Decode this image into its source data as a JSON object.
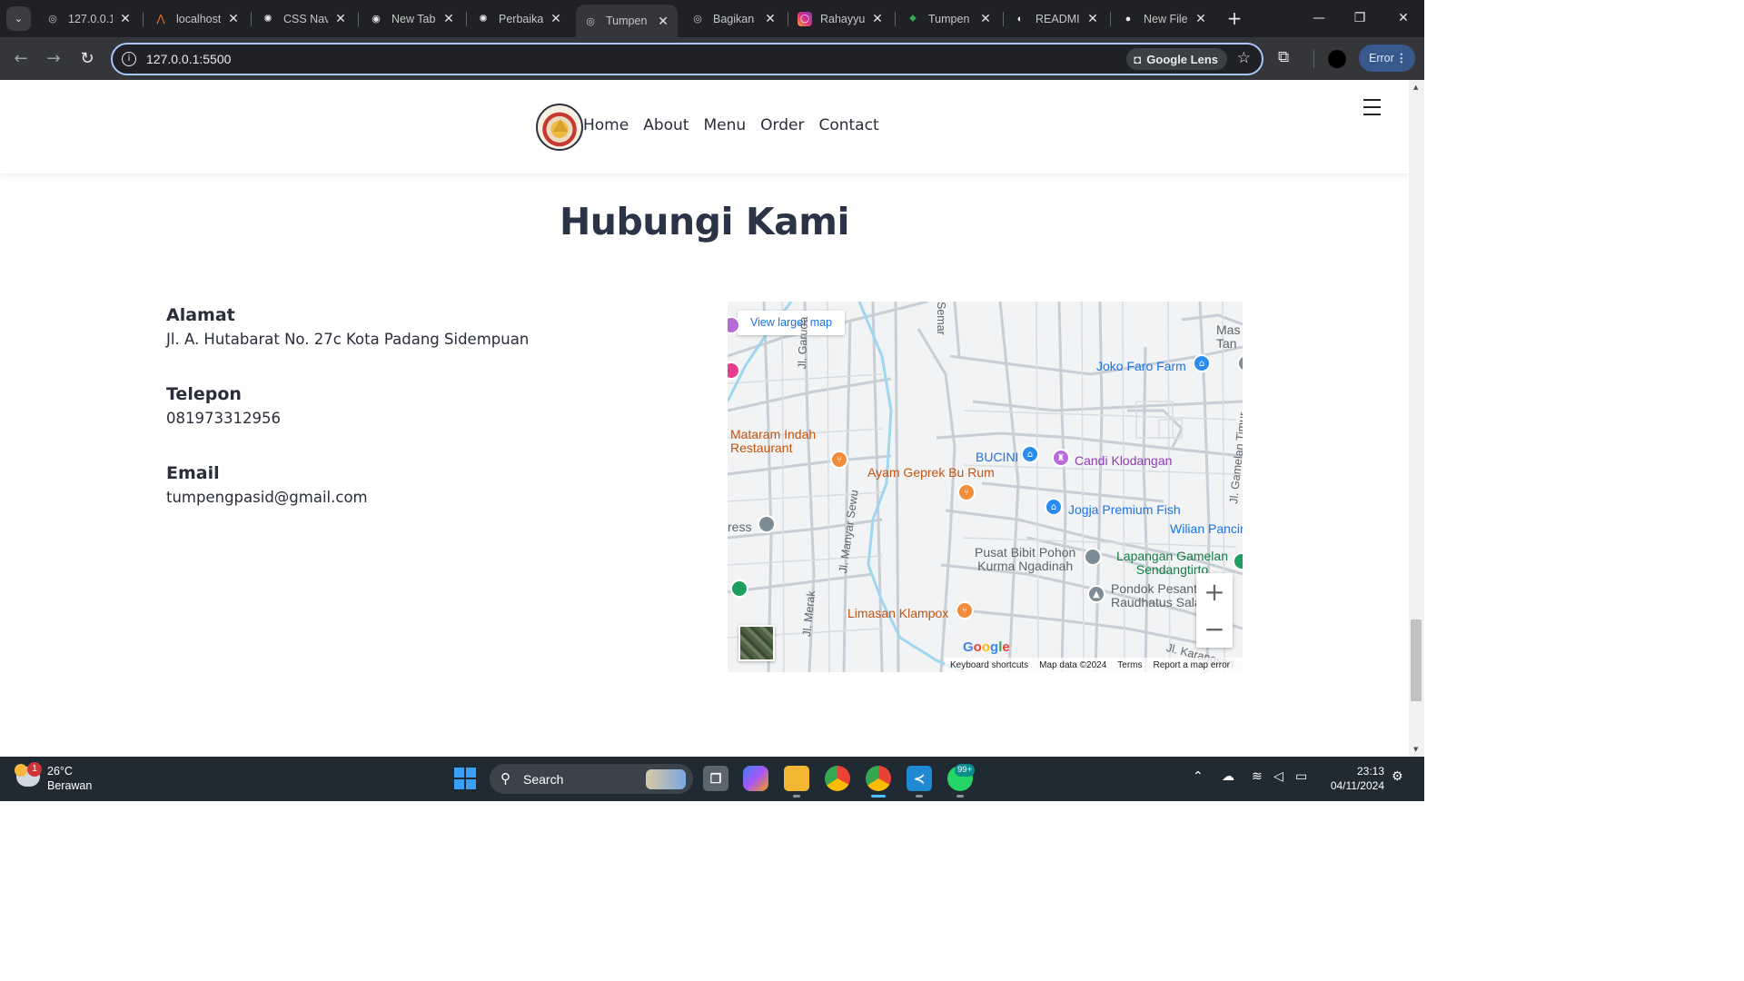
{
  "browser": {
    "tabs": [
      {
        "title": "127.0.0.1",
        "icon": "globe-icon"
      },
      {
        "title": "localhost",
        "icon": "xampp-icon"
      },
      {
        "title": "CSS Nav",
        "icon": "chatgpt-icon"
      },
      {
        "title": "New Tab",
        "icon": "chrome-icon"
      },
      {
        "title": "Perbaika",
        "icon": "chatgpt-icon"
      },
      {
        "title": "Tumpen",
        "icon": "globe-icon",
        "active": true
      },
      {
        "title": "Bagikan",
        "icon": "globe-share-icon"
      },
      {
        "title": "Rahayyu",
        "icon": "instagram-icon"
      },
      {
        "title": "Tumpen",
        "icon": "maps-pin-icon"
      },
      {
        "title": "READMI",
        "icon": "copilot-icon"
      },
      {
        "title": "New File",
        "icon": "github-icon"
      }
    ],
    "url": "127.0.0.1:5500",
    "lens_label": "Google Lens",
    "error_label": "Error"
  },
  "site": {
    "nav": {
      "links": [
        "Home",
        "About",
        "Menu",
        "Order",
        "Contact"
      ]
    },
    "contact": {
      "title": "Hubungi Kami",
      "address_label": "Alamat",
      "address_value": "Jl. A. Hutabarat No. 27c Kota Padang Sidempuan",
      "phone_label": "Telepon",
      "phone_value": "081973312956",
      "email_label": "Email",
      "email_value": "tumpengpasid@gmail.com"
    },
    "map": {
      "view_larger": "View larger map",
      "places": {
        "mataram": "Mataram Indah\nRestaurant",
        "ayam": "Ayam Geprek Bu Rum",
        "bucini": "BUCINI",
        "candi": "Candi Klodangan",
        "joko": "Joko Faro Farm",
        "jogja": "Jogja Premium Fish",
        "wilian": "Wilian Pancir",
        "pusat": "Pusat Bibit Pohon\nKurma Ngadinah",
        "lapangan": "Lapangan Gamelan\nSendangtirto",
        "pondok": "Pondok Pesant\nRaudhatus Sala",
        "limasan": "Limasan Klampox",
        "ress": "ress",
        "mas": "Mas\nTan"
      },
      "roads": {
        "garuda": "Jl. Garuda",
        "manyar": "Jl. Manyar Sewu",
        "merak": "Jl. Merak",
        "semar": "Semar",
        "karangsari": "Jl. Karangsari",
        "gamelan": "Jl. Gamelan Timur"
      },
      "watermark": "Google",
      "footer": {
        "shortcuts": "Keyboard shortcuts",
        "data": "Map data ©2024",
        "terms": "Terms",
        "report": "Report a map error"
      }
    }
  },
  "taskbar": {
    "weather_temp": "26°C",
    "weather_cond": "Berawan",
    "weather_badge": "1",
    "search_label": "Search",
    "whatsapp_badge": "99+",
    "time": "23:13",
    "date": "04/11/2024"
  }
}
